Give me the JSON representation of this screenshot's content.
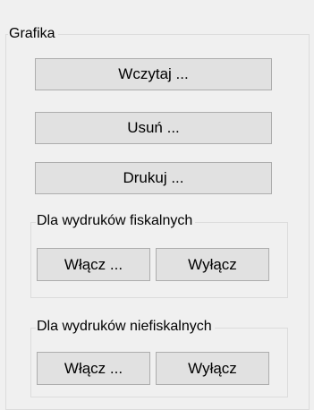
{
  "grafika": {
    "title": "Grafika",
    "load_label": "Wczytaj ...",
    "delete_label": "Usuń ...",
    "print_label": "Drukuj ..."
  },
  "fiscal": {
    "title": "Dla wydruków fiskalnych",
    "enable_label": "Włącz ...",
    "disable_label": "Wyłącz"
  },
  "nonfiscal": {
    "title": "Dla wydruków niefiskalnych",
    "enable_label": "Włącz ...",
    "disable_label": "Wyłącz"
  }
}
